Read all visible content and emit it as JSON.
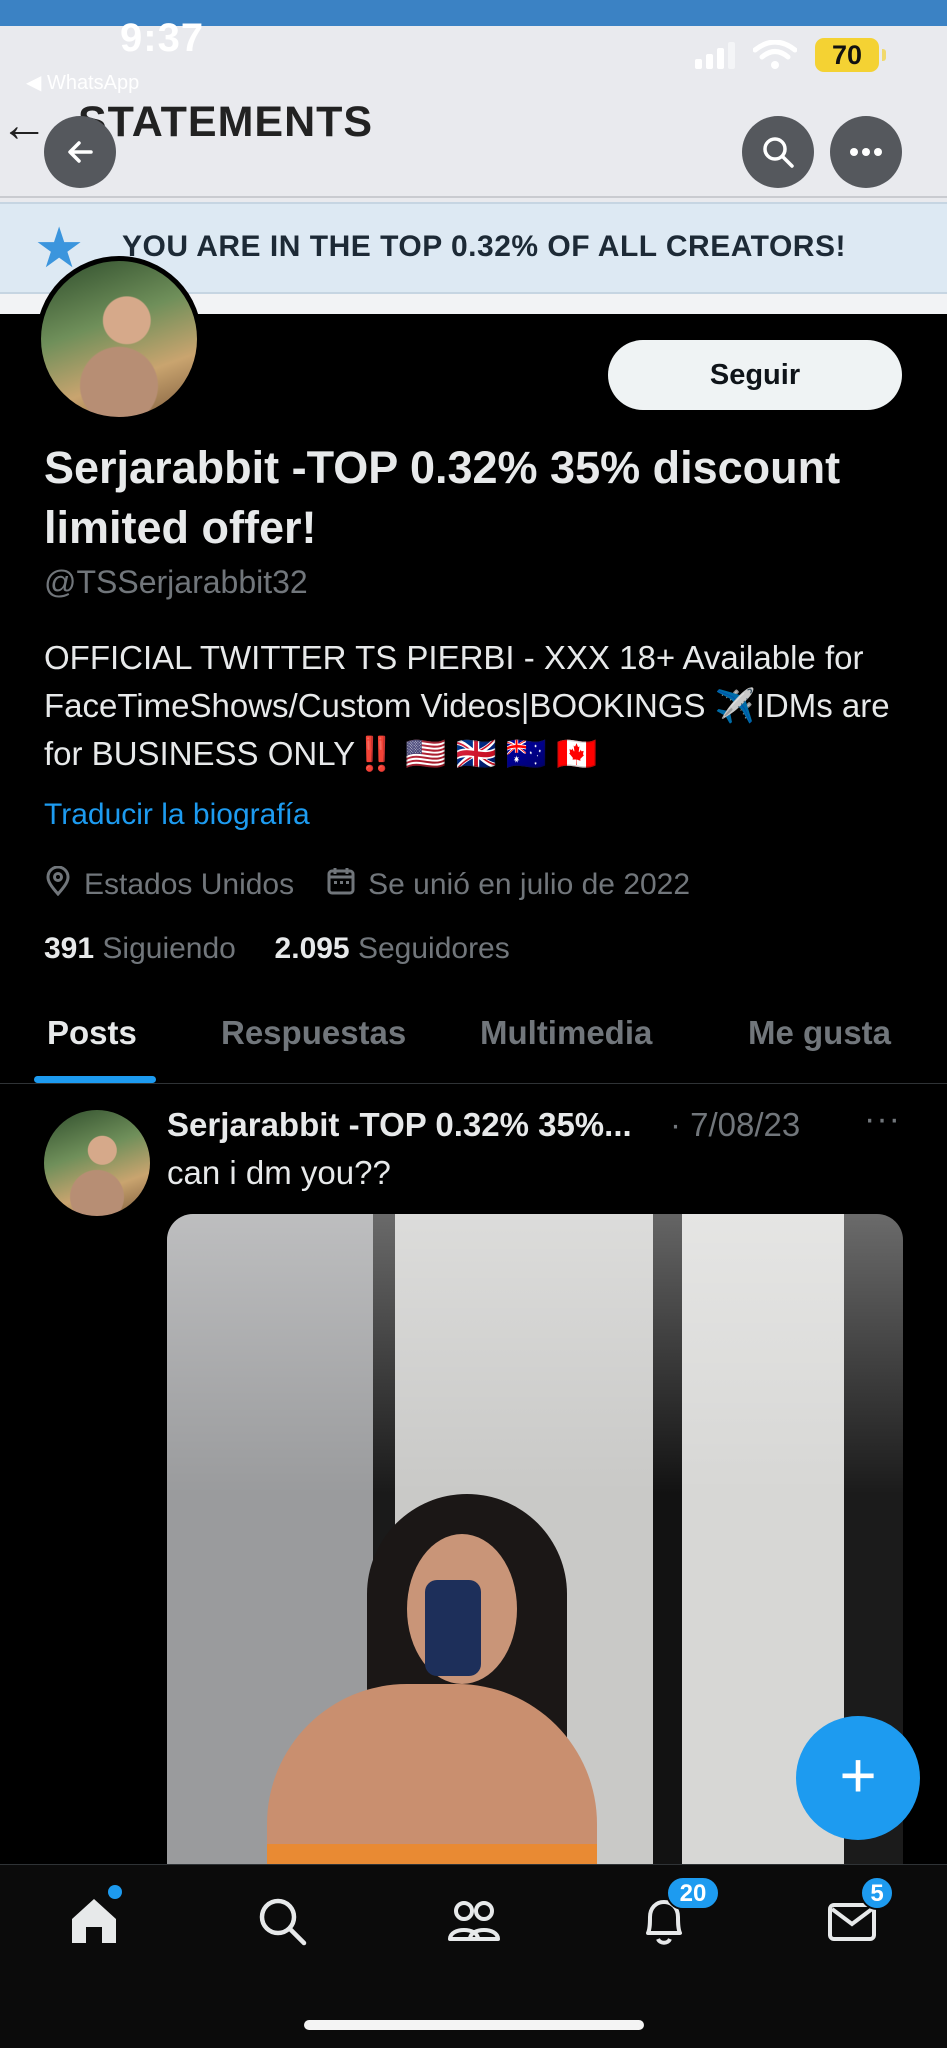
{
  "status_bar": {
    "time": "9:37",
    "back_app": "◀ WhatsApp",
    "battery": "70"
  },
  "background_page": {
    "title": "STATEMENTS"
  },
  "banner": {
    "text": "YOU ARE IN THE TOP 0.32% OF ALL CREATORS!"
  },
  "profile": {
    "follow_label": "Seguir",
    "display_name": "Serjarabbit -TOP 0.32% 35% discount limited offer!",
    "handle": "@TSSerjarabbit32",
    "bio": "OFFICIAL TWITTER TS PIERBI - XXX 18+ Available for FaceTimeShows/Custom Videos|BOOKINGS ✈️IDMs are for BUSINESS ONLY‼️ 🇺🇸 🇬🇧 🇦🇺 🇨🇦",
    "translate_label": "Traducir la biografía",
    "location": "Estados Unidos",
    "joined": "Se unió en julio de 2022",
    "following_count": "391",
    "following_label": "Siguiendo",
    "followers_count": "2.095",
    "followers_label": "Seguidores"
  },
  "tabs": [
    {
      "label": "Posts",
      "active": true
    },
    {
      "label": "Respuestas",
      "active": false
    },
    {
      "label": "Multimedia",
      "active": false
    },
    {
      "label": "Me gusta",
      "active": false
    }
  ],
  "post": {
    "author": "Serjarabbit -TOP 0.32% 35%...",
    "date": "· 7/08/23",
    "more": "···",
    "text": "can i dm you??"
  },
  "fab": {
    "label": "+"
  },
  "bottom_nav": {
    "notifications_badge": "20",
    "messages_badge": "5"
  },
  "colors": {
    "accent": "#1d9bf0",
    "background": "#000000",
    "muted_text": "#71767b",
    "banner_bg": "#dde9f3",
    "battery": "#f4d233"
  },
  "icons": [
    "back-arrow-icon",
    "search-icon",
    "more-icon",
    "star-icon",
    "location-icon",
    "calendar-icon",
    "home-icon",
    "communities-icon",
    "bell-icon",
    "mail-icon"
  ]
}
